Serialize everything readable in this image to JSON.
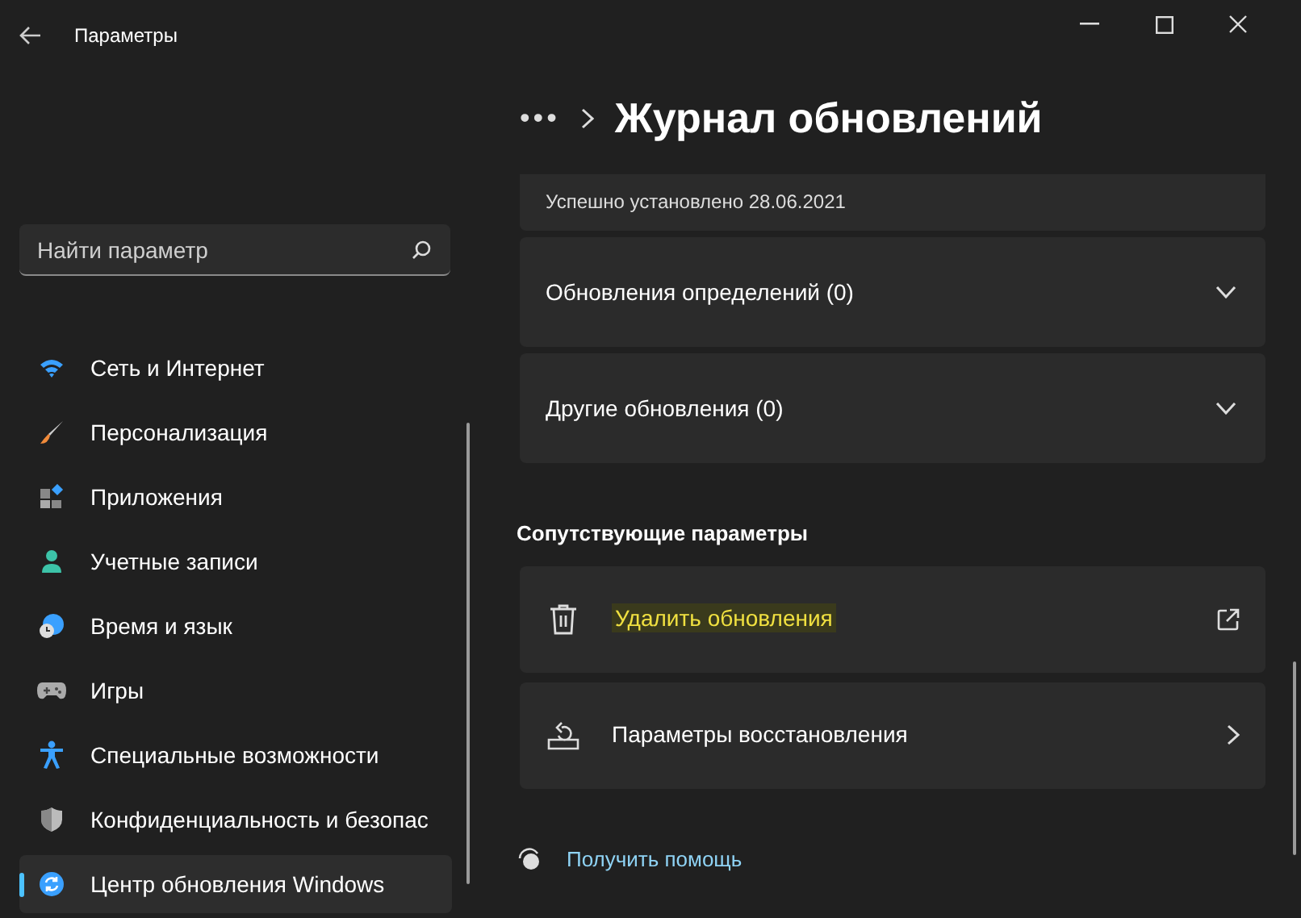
{
  "window": {
    "title": "Параметры"
  },
  "search": {
    "placeholder": "Найти параметр"
  },
  "sidebar": {
    "items": [
      {
        "label": "Сеть и Интернет",
        "selected": false
      },
      {
        "label": "Персонализация",
        "selected": false
      },
      {
        "label": "Приложения",
        "selected": false
      },
      {
        "label": "Учетные записи",
        "selected": false
      },
      {
        "label": "Время и язык",
        "selected": false
      },
      {
        "label": "Игры",
        "selected": false
      },
      {
        "label": "Специальные возможности",
        "selected": false
      },
      {
        "label": "Конфиденциальность и безопас",
        "selected": false
      },
      {
        "label": "Центр обновления Windows",
        "selected": true
      }
    ]
  },
  "header": {
    "breadcrumb": "•••",
    "title": "Журнал обновлений"
  },
  "history": [
    {
      "kind": "status",
      "text": "Успешно установлено 28.06.2021"
    },
    {
      "kind": "group",
      "text": "Обновления определений (0)",
      "expanded": false
    },
    {
      "kind": "group",
      "text": "Другие обновления (0)",
      "expanded": false
    }
  ],
  "related": {
    "title": "Сопутствующие параметры",
    "items": [
      {
        "kind": "external",
        "label": "Удалить обновления",
        "highlighted": true
      },
      {
        "kind": "page",
        "label": "Параметры восстановления",
        "highlighted": false
      }
    ]
  },
  "help": {
    "label": "Получить помощь"
  }
}
